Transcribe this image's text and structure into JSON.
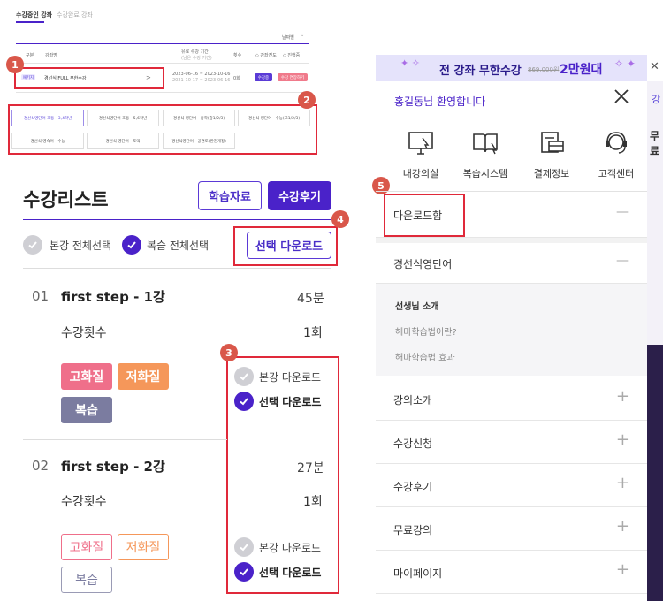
{
  "mini": {
    "tab_active": "수강중인 강좌",
    "tab_inactive": "수강완료 강좌",
    "sort": "날짜별",
    "head_col1": "구분",
    "head_col2": "강좌명",
    "head_col3_line1": "유료 수강 기간",
    "head_col3_line2": "(남은 수강 기간)",
    "head_col4": "횟수",
    "head_col5": "◇ 강좌진도",
    "head_col6": "◇ 진행중",
    "row_badge": "패키지",
    "row_title": "경선식 FULL 무한수강",
    "row_arrow": ">",
    "row_date1": "2023-06-16 ~ 2023-10-16",
    "row_date2": "2021-10-17 ~ 2023-06-16",
    "row_count": "0회",
    "row_btn1": "수강중",
    "row_btn2": "수강 연장하기",
    "chips": [
      "경선식영단어 초등 - 3,4학년",
      "경선식영단어 초등 - 5,6학년",
      "경선식 영단어 - 중학(중1/2/3)",
      "경선식 영단어 - 수능(고1/2/3)",
      "경선식 영숙어 - 수능",
      "경선식 영단어 - 토익",
      "경선식영단어 - 공편토(완전개정)"
    ]
  },
  "list": {
    "title": "수강리스트",
    "btn_material": "학습자료",
    "btn_review": "수강후기",
    "select_main": "본강 전체선택",
    "select_review": "복습 전체선택",
    "btn_download": "선택 다운로드",
    "items": [
      {
        "no": "01",
        "title": "first step - 1강",
        "duration": "45분",
        "count_label": "수강횟수",
        "count": "1회",
        "tag_hq": "고화질",
        "tag_lq": "저화질",
        "tag_rev": "복습",
        "dl_main": "본강 다운로드",
        "dl_sel": "선택 다운로드"
      },
      {
        "no": "02",
        "title": "first step - 2강",
        "duration": "27분",
        "count_label": "수강횟수",
        "count": "1회",
        "tag_hq": "고화질",
        "tag_lq": "저화질",
        "tag_rev": "복습",
        "dl_main": "본강 다운로드",
        "dl_sel": "선택 다운로드"
      }
    ]
  },
  "markers": [
    "1",
    "2",
    "3",
    "4",
    "5"
  ],
  "panel": {
    "banner_text": "전 강좌 무한수강",
    "banner_old_price": "869,000원",
    "banner_new_price": "2만원대",
    "greeting_name": "홍길동",
    "greeting_suffix": "님 환영합니다",
    "icons": [
      {
        "label": "내강의실",
        "icon": "monitor-click-icon"
      },
      {
        "label": "복습시스템",
        "icon": "book-cursor-icon"
      },
      {
        "label": "결제정보",
        "icon": "payment-card-icon"
      },
      {
        "label": "고객센터",
        "icon": "headset-icon"
      }
    ],
    "download_box": "다운로드함",
    "word_title": "경선식영단어",
    "sub_head": "선생님 소개",
    "sub_items": [
      "해마학습법이란?",
      "해마학습법 효과"
    ],
    "menus": [
      "강의소개",
      "수강신청",
      "수강후기",
      "무료강의",
      "마이페이지"
    ],
    "minus": "—",
    "plus": "+",
    "edge_text": "무료",
    "edge_text2": "강"
  },
  "colors": {
    "accent": "#4a22c9",
    "red": "#e0293a",
    "marker": "#d9574a",
    "tag_hq": "#ef6f8a",
    "tag_lq": "#f5975a",
    "tag_rev": "#7b7ca0"
  }
}
